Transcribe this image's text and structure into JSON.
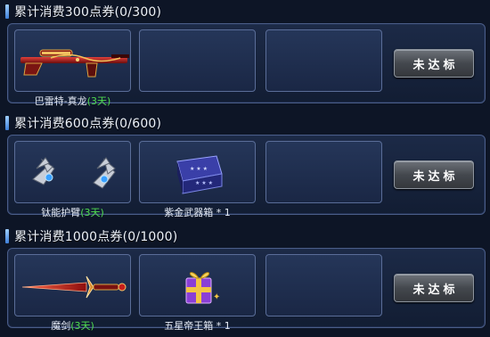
{
  "tiers": [
    {
      "title": "累计消费300点券(0/300)",
      "items": [
        {
          "name": "巴雷特-真龙",
          "duration": "(3天)",
          "icon": "barrett-dragon-sniper-rifle-icon"
        }
      ],
      "status_label": "未达标"
    },
    {
      "title": "累计消费600点券(0/600)",
      "items": [
        {
          "name": "钛能护臂",
          "duration": "(3天)",
          "icon": "titanium-arm-guards-icon"
        },
        {
          "name": "紫金武器箱 * 1",
          "duration": "",
          "icon": "purple-gold-weapon-case-icon"
        }
      ],
      "status_label": "未达标"
    },
    {
      "title": "累计消费1000点券(0/1000)",
      "items": [
        {
          "name": "魔剑",
          "duration": "(3天)",
          "icon": "demon-sword-icon"
        },
        {
          "name": "五星帝王箱 * 1",
          "duration": "",
          "icon": "five-star-emperor-box-icon"
        }
      ],
      "status_label": "未达标"
    }
  ],
  "colors": {
    "duration_text": "#4fdc4f",
    "panel_border": "#4a5d88",
    "slot_bg": "#253659"
  }
}
